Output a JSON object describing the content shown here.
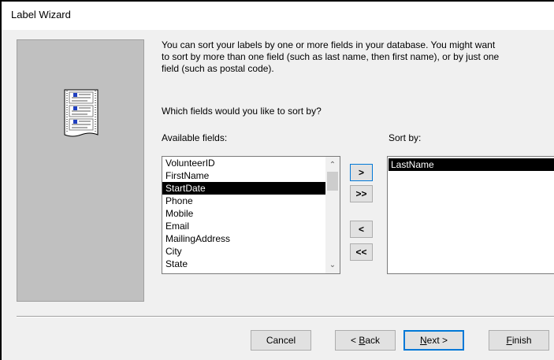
{
  "window": {
    "title": "Label Wizard"
  },
  "instructions": {
    "line1": "You can sort your labels by one or more fields in your database.  You might want",
    "line2": "to sort by more than one field (such as last name, then first name), or by just one",
    "line3": "field (such as postal code).",
    "question": "Which fields would you like to sort by?"
  },
  "available": {
    "label": "Available fields:",
    "items": [
      "VolunteerID",
      "FirstName",
      "StartDate",
      "Phone",
      "Mobile",
      "Email",
      "MailingAddress",
      "City",
      "State"
    ],
    "selected": "StartDate"
  },
  "sort_by": {
    "label": "Sort by:",
    "items": [
      "LastName"
    ]
  },
  "move_buttons": {
    "add_one": ">",
    "add_all": ">>",
    "remove_one": "<",
    "remove_all": "<<"
  },
  "buttons": {
    "cancel": "Cancel",
    "back_prefix": "< ",
    "back_accel": "B",
    "back_rest": "ack",
    "next_accel": "N",
    "next_rest": "ext >",
    "finish_accel": "F",
    "finish_rest": "inish"
  },
  "icons": {
    "scroll_up": "chevron-up-icon",
    "scroll_down": "chevron-down-icon",
    "illustration": "label-sheet-icon"
  }
}
